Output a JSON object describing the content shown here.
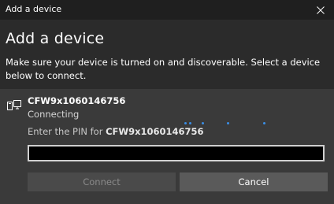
{
  "window": {
    "title": "Add a device"
  },
  "heading": "Add a device",
  "description": "Make sure your device is turned on and discoverable. Select a device below to connect.",
  "device": {
    "icon": "computer-device-icon",
    "name": "CFW9x1060146756",
    "status": "Connecting",
    "pin_prompt_prefix": "Enter the PIN for ",
    "pin_prompt_device": "CFW9x1060146756"
  },
  "pin_input": {
    "value": "",
    "placeholder": ""
  },
  "buttons": {
    "connect_label": "Connect",
    "cancel_label": "Cancel"
  },
  "colors": {
    "accent": "#3a8ee6",
    "background": "#2b2b2b",
    "panel": "#3a3a3a",
    "titlebar": "#1f1f1f"
  }
}
